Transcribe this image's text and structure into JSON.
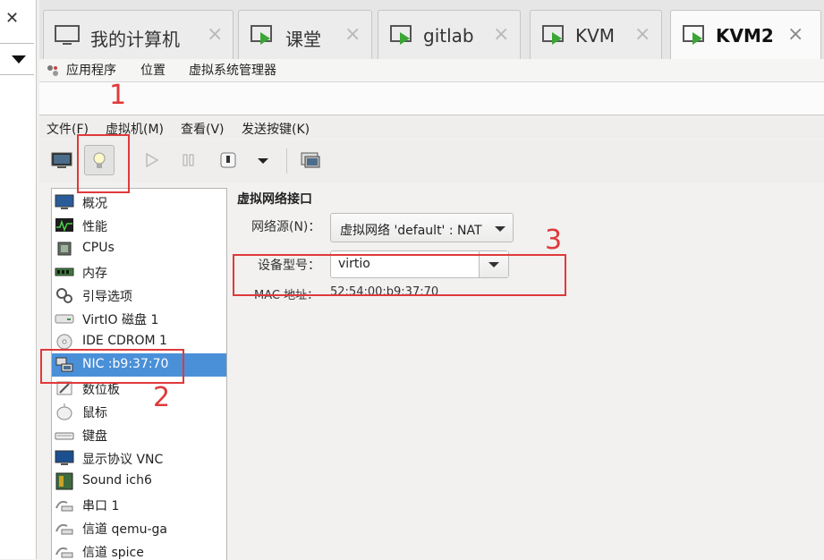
{
  "left_panel": {
    "close_icon": "close-icon",
    "dropdown_icon": "chevron-down-icon"
  },
  "tabs": [
    {
      "label": "我的计算机",
      "icon": "computer-monitor-icon",
      "active": false
    },
    {
      "label": "课堂",
      "icon": "vm-console-icon",
      "active": false
    },
    {
      "label": "gitlab",
      "icon": "vm-console-icon",
      "active": false
    },
    {
      "label": "KVM",
      "icon": "vm-console-icon",
      "active": false
    },
    {
      "label": "KVM2",
      "icon": "vm-console-icon",
      "active": true
    }
  ],
  "tab_close_glyph": "×",
  "app_menu": {
    "applications": "应用程序",
    "places": "位置",
    "virt_manager": "虚拟系统管理器"
  },
  "window_menu": {
    "file": "文件(F)",
    "vm": "虚拟机(M)",
    "view": "查看(V)",
    "send_key": "发送按键(K)"
  },
  "toolbar": {
    "console_icon": "monitor-icon",
    "details_icon": "lightbulb-icon",
    "run_icon": "play-icon",
    "pause_icon": "pause-icon",
    "shutdown_icon": "power-icon",
    "menu_icon": "chevron-down-icon",
    "fullscreen_icon": "fullscreen-icon"
  },
  "hardware_list": [
    {
      "label": "概况",
      "icon": "overview-icon"
    },
    {
      "label": "性能",
      "icon": "performance-icon"
    },
    {
      "label": "CPUs",
      "icon": "cpu-icon"
    },
    {
      "label": "内存",
      "icon": "memory-icon"
    },
    {
      "label": "引导选项",
      "icon": "boot-options-icon"
    },
    {
      "label": "VirtIO 磁盘 1",
      "icon": "disk-icon"
    },
    {
      "label": "IDE CDROM 1",
      "icon": "cdrom-icon"
    },
    {
      "label": "NIC :b9:37:70",
      "icon": "network-icon",
      "selected": true
    },
    {
      "label": "数位板",
      "icon": "tablet-icon"
    },
    {
      "label": "鼠标",
      "icon": "mouse-icon"
    },
    {
      "label": "键盘",
      "icon": "keyboard-icon"
    },
    {
      "label": "显示协议 VNC",
      "icon": "display-icon"
    },
    {
      "label": "Sound ich6",
      "icon": "sound-icon"
    },
    {
      "label": "串口 1",
      "icon": "serial-icon"
    },
    {
      "label": "信道 qemu-ga",
      "icon": "channel-icon"
    },
    {
      "label": "信道 spice",
      "icon": "channel-icon"
    }
  ],
  "details": {
    "title": "虚拟网络接口",
    "network_source_label": "网络源(N)：",
    "network_source_value": "虚拟网络 'default' : NAT",
    "device_model_label": "设备型号：",
    "device_model_value": "virtio",
    "mac_label": "MAC 地址：",
    "mac_value": "52:54:00:b9:37:70"
  },
  "annotations": {
    "n1": "1",
    "n2": "2",
    "n3": "3"
  },
  "colors": {
    "selection": "#4a90d9",
    "annotation_red": "#e0393b",
    "vm_arrow_green": "#3aa635"
  }
}
